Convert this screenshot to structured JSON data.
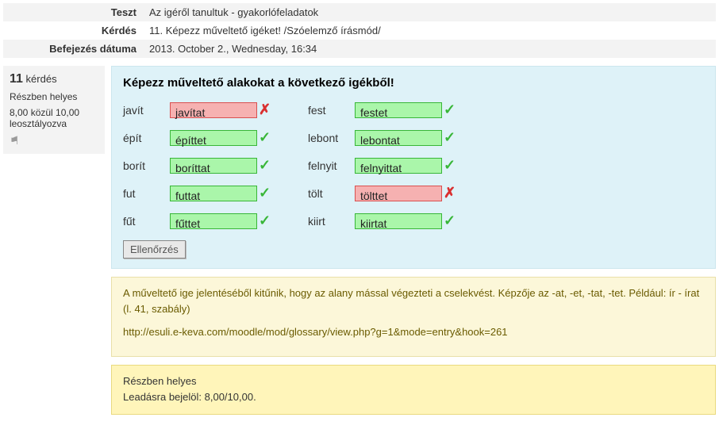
{
  "info": {
    "test_label": "Teszt",
    "test_value": "Az igéről tanultuk - gyakorlófeladatok",
    "question_label": "Kérdés",
    "question_value": "11. Képezz műveltető igéket! /Szóelemző írásmód/",
    "completed_label": "Befejezés dátuma",
    "completed_value": "2013. October 2., Wednesday, 16:34"
  },
  "sidebar": {
    "number": "11",
    "number_suffix": "kérdés",
    "state": "Részben helyes",
    "grade": "8,00 közül 10,00 leosztályozva"
  },
  "question": {
    "text": "Képezz műveltető alakokat a következő igékből!",
    "check_label": "Ellenőrzés"
  },
  "answers": [
    {
      "label": "javít",
      "value": "javítat",
      "correct": false
    },
    {
      "label": "fest",
      "value": "festet",
      "correct": true
    },
    {
      "label": "épít",
      "value": "építtet",
      "correct": true
    },
    {
      "label": "lebont",
      "value": "lebontat",
      "correct": true
    },
    {
      "label": "borít",
      "value": "boríttat",
      "correct": true
    },
    {
      "label": "felnyit",
      "value": "felnyittat",
      "correct": true
    },
    {
      "label": "fut",
      "value": "futtat",
      "correct": true
    },
    {
      "label": "tölt",
      "value": "tölttet",
      "correct": false
    },
    {
      "label": "fűt",
      "value": "fűttet",
      "correct": true
    },
    {
      "label": "kiirt",
      "value": "kiirtat",
      "correct": true
    }
  ],
  "feedback": {
    "p1": "A műveltető ige jelentéséből kitűnik, hogy az alany mással végezteti a cselekvést. Képzője az -at, -et, -tat, -tet. Például: ír - írat (l. 41, szabály)",
    "p2": "http://esuli.e-keva.com/moodle/mod/glossary/view.php?g=1&mode=entry&hook=261"
  },
  "outcome": {
    "state": "Részben helyes",
    "mark": "Leadásra bejelöl: 8,00/10,00."
  }
}
